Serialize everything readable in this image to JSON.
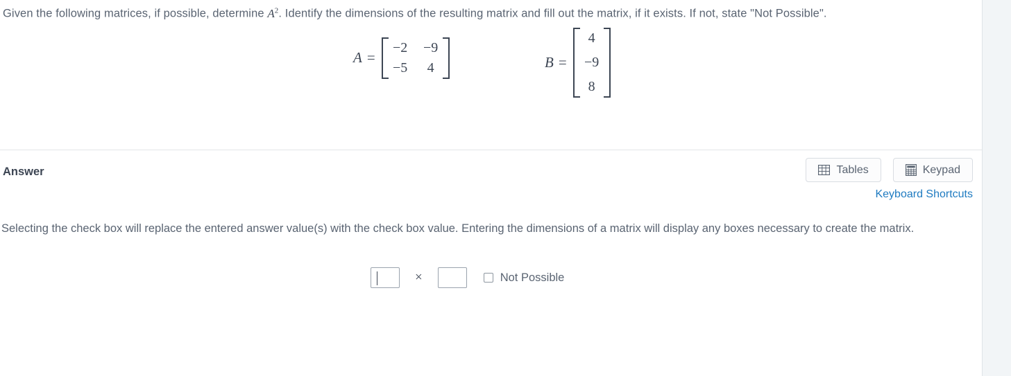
{
  "question": {
    "prefix": "Given the following matrices, if possible, determine ",
    "math_base": "A",
    "math_exponent": "2",
    "suffix": ". Identify the dimensions of the resulting matrix and fill out the matrix, if it exists. If not, state \"Not Possible\"."
  },
  "matrices": [
    {
      "name": "A",
      "equals": "=",
      "rows": 2,
      "cols": 2,
      "cells": [
        "−2",
        "−9",
        "−5",
        "4"
      ]
    },
    {
      "name": "B",
      "equals": "=",
      "rows": 3,
      "cols": 1,
      "cells": [
        "4",
        "−9",
        "8"
      ]
    }
  ],
  "answer": {
    "title": "Answer",
    "tools": [
      {
        "label": "Tables",
        "icon": "table-grid-icon"
      },
      {
        "label": "Keypad",
        "icon": "calculator-keypad-icon"
      }
    ],
    "shortcuts_link": "Keyboard Shortcuts",
    "instructions": "Selecting the check box will replace the entered answer value(s) with the check box value. Entering the dimensions of a matrix will display any boxes necessary to create the matrix.",
    "dimension": {
      "rows_value": "",
      "rows_placeholder": "",
      "separator": "×",
      "cols_value": "",
      "cols_placeholder": "",
      "not_possible_label": "Not Possible",
      "not_possible_checked": false
    }
  },
  "colors": {
    "text": "#5a6472",
    "heading": "#3d4654",
    "link": "#1f7bc1",
    "divider": "#e3e6e8",
    "button_border": "#d9dde2",
    "gutter": "#f2f5f7"
  }
}
